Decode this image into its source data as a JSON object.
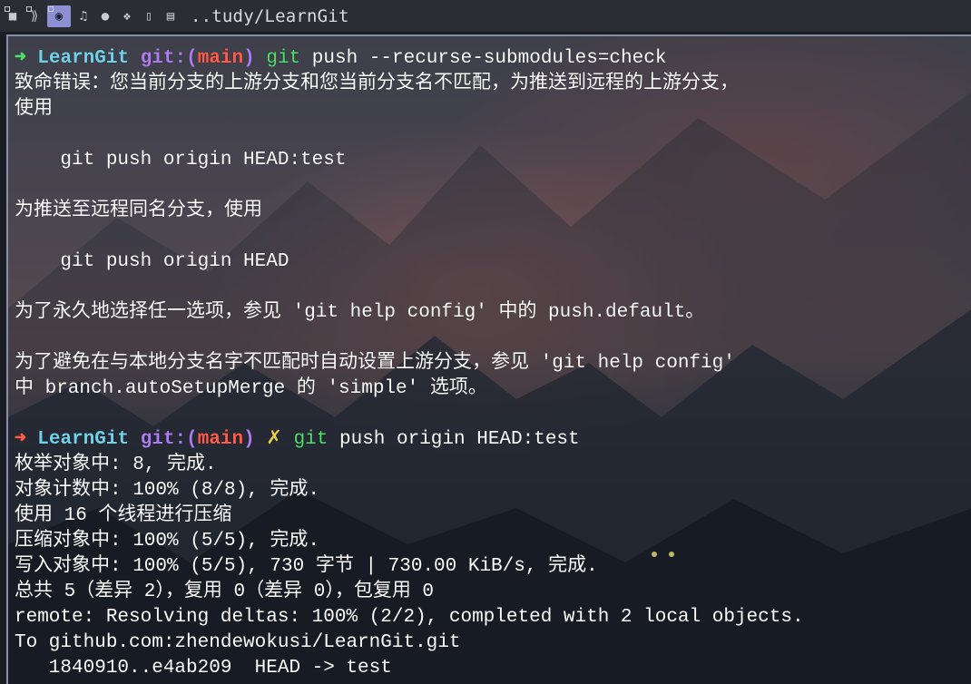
{
  "topbar": {
    "icons": [
      "terminal-icon",
      "vscode-icon",
      "chrome-icon",
      "music-icon",
      "chat-icon",
      "cubes-icon",
      "question-icon",
      "book-icon"
    ],
    "title": "..tudy/LearnGit"
  },
  "terminal": {
    "prompt1": {
      "arrow": "➜",
      "dir": "LearnGit",
      "git_label": "git:(",
      "branch": "main",
      "close": ")",
      "cmd": "git",
      "args": " push --recurse-submodules=check"
    },
    "out1": [
      "致命错误：您当前分支的上游分支和您当前分支名不匹配，为推送到远程的上游分支，",
      "使用",
      "",
      "    git push origin HEAD:test",
      "",
      "为推送至远程同名分支，使用",
      "",
      "    git push origin HEAD",
      "",
      "为了永久地选择任一选项，参见 'git help config' 中的 push.default。",
      "",
      "为了避免在与本地分支名字不匹配时自动设置上游分支，参见 'git help config'",
      "中 branch.autoSetupMerge 的 'simple' 选项。",
      ""
    ],
    "prompt2": {
      "arrow": "➜",
      "dir": "LearnGit",
      "git_label": "git:(",
      "branch": "main",
      "close": ")",
      "dirty": "✗",
      "cmd": "git",
      "args": " push origin HEAD:test"
    },
    "out2": [
      "枚举对象中: 8, 完成.",
      "对象计数中: 100% (8/8), 完成.",
      "使用 16 个线程进行压缩",
      "压缩对象中: 100% (5/5), 完成.",
      "写入对象中: 100% (5/5), 730 字节 | 730.00 KiB/s, 完成.",
      "总共 5（差异 2），复用 0（差异 0），包复用 0",
      "remote: Resolving deltas: 100% (2/2), completed with 2 local objects.",
      "To github.com:zhendewokusi/LearnGit.git",
      "   1840910..e4ab209  HEAD -> test"
    ]
  }
}
